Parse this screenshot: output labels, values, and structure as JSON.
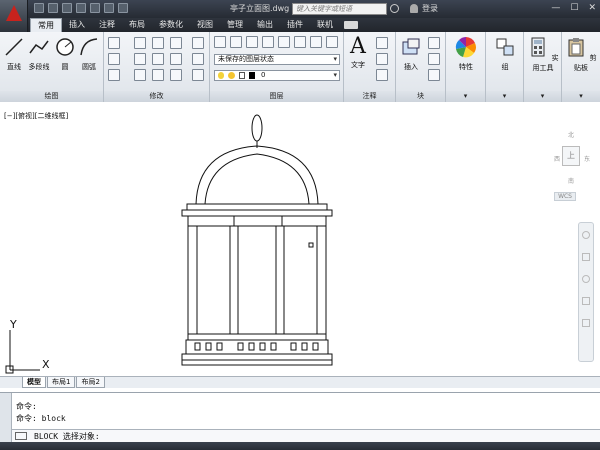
{
  "title_bar": {
    "document_title": "亭子立面图.dwg",
    "search_placeholder": "键入关键字或短语",
    "login_label": "登录",
    "window_buttons": [
      "—",
      "☐",
      "✕"
    ]
  },
  "ribbon_tabs": [
    "常用",
    "插入",
    "注释",
    "布局",
    "参数化",
    "视图",
    "管理",
    "输出",
    "插件",
    "联机"
  ],
  "active_tab": "常用",
  "ribbon": {
    "draw_panel": {
      "title": "绘图",
      "tools": [
        "直线",
        "多段线",
        "圆",
        "圆弧"
      ]
    },
    "modify_panel": {
      "title": "修改"
    },
    "layers_panel": {
      "title": "图层",
      "layer_state": "未保存的图层状态",
      "current_layer": "0"
    },
    "annotation_panel": {
      "title": "注释",
      "text_label": "文字"
    },
    "block_panel": {
      "title": "块",
      "insert_label": "插入"
    },
    "properties_label": "特性",
    "groups_label": "组",
    "utilities_label": "实用工具",
    "clipboard_label": "剪贴板"
  },
  "viewport_label": "[−][俯视][二维线框]",
  "navcube": {
    "top": "北",
    "left": "西",
    "right": "东",
    "bottom": "南",
    "face": "上",
    "wcs": "WCS"
  },
  "ucs": {
    "x": "X",
    "y": "Y"
  },
  "layout_tabs": [
    "模型",
    "布局1",
    "布局2"
  ],
  "command_history": [
    "命令:",
    "命令: block"
  ],
  "command_prompt": "BLOCK 选择对象:"
}
